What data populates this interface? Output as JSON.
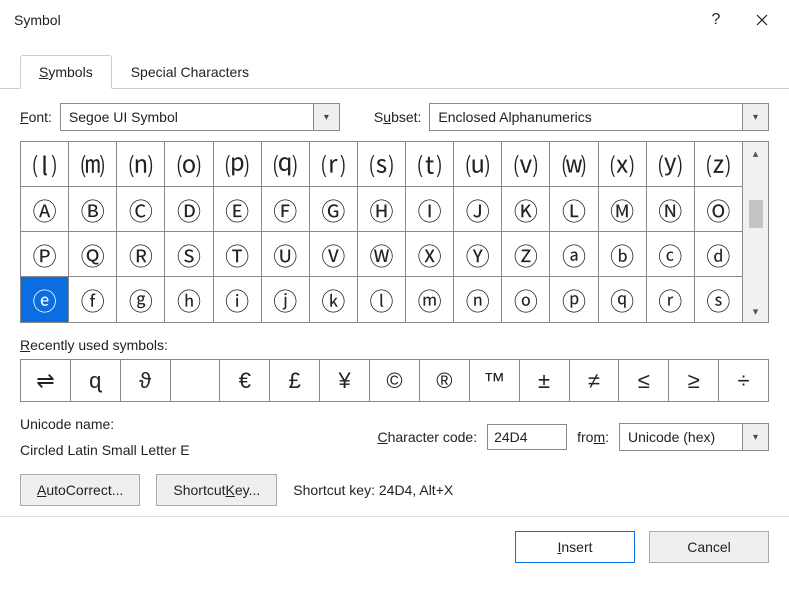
{
  "window": {
    "title": "Symbol"
  },
  "tabs": {
    "symbols": "Symbols",
    "special": "Special Characters",
    "und_s": "S",
    "und_p": "P"
  },
  "font": {
    "label_pre": "F",
    "label_rest": "ont:",
    "value": "Segoe UI Symbol"
  },
  "subset": {
    "label_pre": "S",
    "label_u": "u",
    "label_rest": "bset:",
    "value": "Enclosed Alphanumerics"
  },
  "grid_rows": [
    [
      "⒧",
      "⒨",
      "⒩",
      "⒪",
      "⒫",
      "⒬",
      "⒭",
      "⒮",
      "⒯",
      "⒰",
      "⒱",
      "⒲",
      "⒳",
      "⒴",
      "⒵"
    ],
    [
      "Ⓐ",
      "Ⓑ",
      "Ⓒ",
      "Ⓓ",
      "Ⓔ",
      "Ⓕ",
      "Ⓖ",
      "Ⓗ",
      "Ⓘ",
      "Ⓙ",
      "Ⓚ",
      "Ⓛ",
      "Ⓜ",
      "Ⓝ",
      "Ⓞ"
    ],
    [
      "Ⓟ",
      "Ⓠ",
      "Ⓡ",
      "Ⓢ",
      "Ⓣ",
      "Ⓤ",
      "Ⓥ",
      "Ⓦ",
      "Ⓧ",
      "Ⓨ",
      "Ⓩ",
      "ⓐ",
      "ⓑ",
      "ⓒ",
      "ⓓ"
    ],
    [
      "ⓔ",
      "ⓕ",
      "ⓖ",
      "ⓗ",
      "ⓘ",
      "ⓙ",
      "ⓚ",
      "ⓛ",
      "ⓜ",
      "ⓝ",
      "ⓞ",
      "ⓟ",
      "ⓠ",
      "ⓡ",
      "ⓢ"
    ]
  ],
  "selected": {
    "row": 3,
    "col": 0
  },
  "recent": {
    "label_pre": "R",
    "label_rest": "ecently used symbols:",
    "items": [
      "⇌",
      "ɋ",
      "ϑ",
      " ",
      "€",
      "£",
      "¥",
      "©",
      "®",
      "™",
      "±",
      "≠",
      "≤",
      "≥",
      "÷"
    ]
  },
  "unicode": {
    "name_label": "Unicode name:",
    "name_value": "Circled Latin Small Letter E",
    "code_label_pre": "C",
    "code_label_rest": "haracter code:",
    "code_value": "24D4",
    "from_label_pre": "fro",
    "from_u": "m",
    "from_rest": ":",
    "from_value": "Unicode (hex)"
  },
  "buttons": {
    "autocorrect": "AutoCorrect...",
    "shortcut": "Shortcut Key...",
    "insert": "Insert",
    "cancel": "Cancel",
    "ac_u": "A",
    "ac_rest": "utoCorrect...",
    "sk_pre": "Shortcut ",
    "sk_u": "K",
    "sk_rest": "ey...",
    "ins_u": "I",
    "ins_rest": "nsert"
  },
  "shortcut_info": "Shortcut key: 24D4, Alt+X"
}
